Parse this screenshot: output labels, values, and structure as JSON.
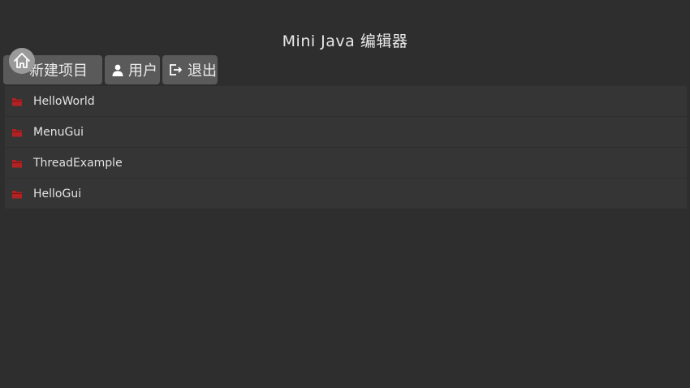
{
  "app": {
    "title": "Mini  Java  编辑器"
  },
  "toolbar": {
    "new_project_label": "新建项目",
    "user_label": "用户",
    "exit_label": "退出"
  },
  "projects": [
    {
      "name": "HelloWorld"
    },
    {
      "name": "MenuGui"
    },
    {
      "name": "ThreadExample"
    },
    {
      "name": "HelloGui"
    }
  ],
  "icons": {
    "home": "home-icon",
    "user": "user-icon",
    "exit": "exit-icon",
    "project": "project-folder-icon"
  },
  "colors": {
    "background": "#2e2e2e",
    "button": "#5a5a5a",
    "row": "#353535",
    "project_icon": "#b22222",
    "text": "#e6e6e6"
  }
}
